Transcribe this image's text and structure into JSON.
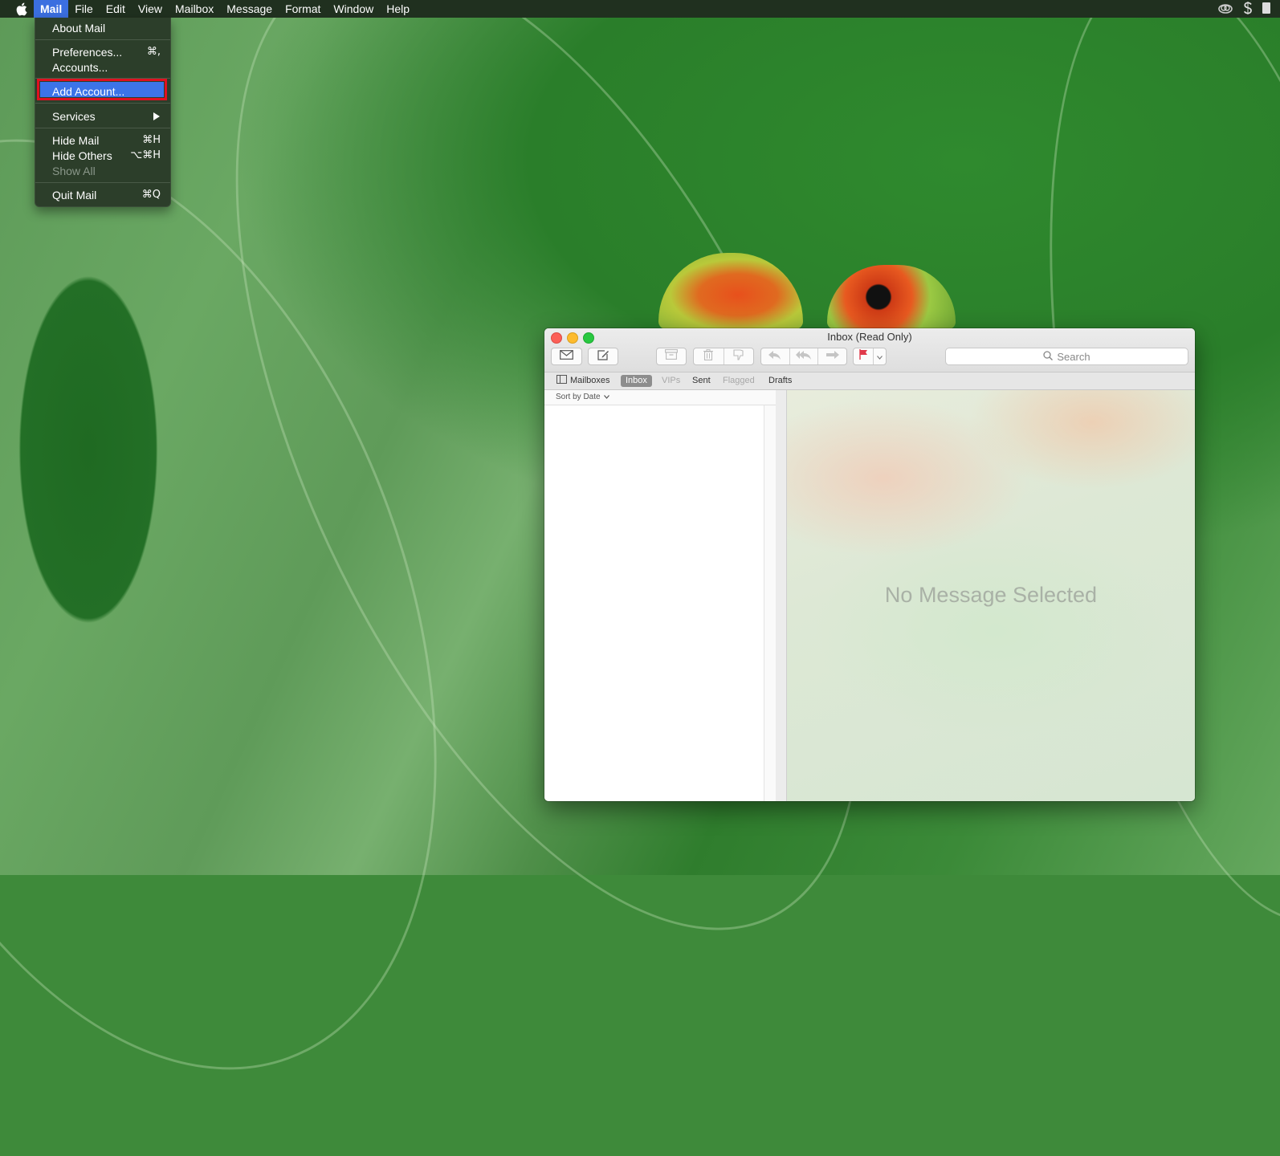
{
  "menubar": {
    "app_menu": "Mail",
    "items": [
      "File",
      "Edit",
      "View",
      "Mailbox",
      "Message",
      "Format",
      "Window",
      "Help"
    ]
  },
  "mail_menu": {
    "about": "About Mail",
    "preferences": "Preferences...",
    "preferences_shortcut": "⌘,",
    "accounts": "Accounts...",
    "add_account": "Add Account...",
    "services": "Services",
    "hide_mail": "Hide Mail",
    "hide_mail_shortcut": "⌘H",
    "hide_others": "Hide Others",
    "hide_others_shortcut": "⌥⌘H",
    "show_all": "Show All",
    "quit": "Quit Mail",
    "quit_shortcut": "⌘Q"
  },
  "window": {
    "title": "Inbox (Read Only)",
    "search_placeholder": "Search",
    "favorites": {
      "mailboxes": "Mailboxes",
      "inbox": "Inbox",
      "vips": "VIPs",
      "sent": "Sent",
      "flagged": "Flagged",
      "drafts": "Drafts"
    },
    "sort_label": "Sort by Date",
    "no_message": "No Message Selected"
  },
  "colors": {
    "highlight_border": "#e01020",
    "menu_selection": "#3c74e8",
    "flag": "#e0394a"
  }
}
